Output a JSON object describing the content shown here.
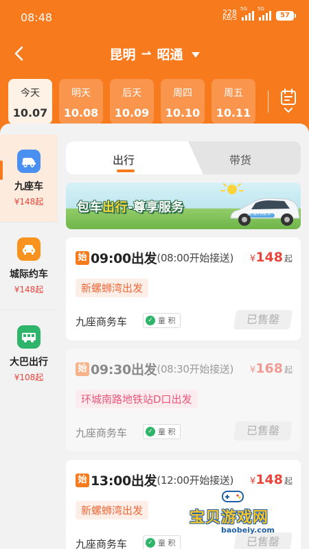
{
  "status_bar": {
    "time": "08:48",
    "net_speed": "228",
    "net_unit": "KB/S",
    "sig1": "5G",
    "sig2": "5G",
    "battery": "57"
  },
  "nav": {
    "from": "昆明",
    "arrow": "⇀",
    "to": "昭通"
  },
  "date_tabs": [
    {
      "label": "今天",
      "date": "10.07",
      "active": true
    },
    {
      "label": "明天",
      "date": "10.08"
    },
    {
      "label": "后天",
      "date": "10.09"
    },
    {
      "label": "周四",
      "date": "10.10"
    },
    {
      "label": "周五",
      "date": "10.11"
    }
  ],
  "sidebar": [
    {
      "name": "九座车",
      "price": "¥148起",
      "icon": "minibus-icon",
      "color": "#4a90f0"
    },
    {
      "name": "城际约车",
      "price": "¥148起",
      "icon": "car-icon",
      "color": "#f7931e"
    },
    {
      "name": "大巴出行",
      "price": "¥108起",
      "icon": "bus-icon",
      "color": "#2fb46b"
    }
  ],
  "segment": {
    "tab1": "出行",
    "tab2": "带货"
  },
  "banner": {
    "part1": "包车",
    "part2": "出行",
    "part3": "-尊享服务",
    "car_label": "要请约租车"
  },
  "cards": [
    {
      "tag": "始",
      "time": "09:00出发",
      "pickup": "(08:00开始接送)",
      "yen": "¥",
      "price": "148",
      "qi": "起",
      "location": "新螺蛳湾出发",
      "loc_style": "orange",
      "vehicle": "九座商务车",
      "badge": "童 积",
      "status": "已售罄",
      "faded": false
    },
    {
      "tag": "始",
      "time": "09:30出发",
      "pickup": "(08:30开始接送)",
      "yen": "¥",
      "price": "168",
      "qi": "起",
      "location": "环城南路地铁站D口出发",
      "loc_style": "pink",
      "vehicle": "九座商务车",
      "badge": "童 积",
      "status": "已售罄",
      "faded": true
    },
    {
      "tag": "始",
      "time": "13:00出发",
      "pickup": "(12:00开始接送)",
      "yen": "¥",
      "price": "148",
      "qi": "起",
      "location": "新螺蛳湾出发",
      "loc_style": "orange",
      "vehicle": "九座商务车",
      "badge": "童 积",
      "status": "已售罄",
      "faded": false
    }
  ],
  "watermark": {
    "text": "宝贝游戏网",
    "url": "baobeiy.com"
  },
  "colors": {
    "brand": "#f77a1d",
    "price": "#e8443a"
  }
}
